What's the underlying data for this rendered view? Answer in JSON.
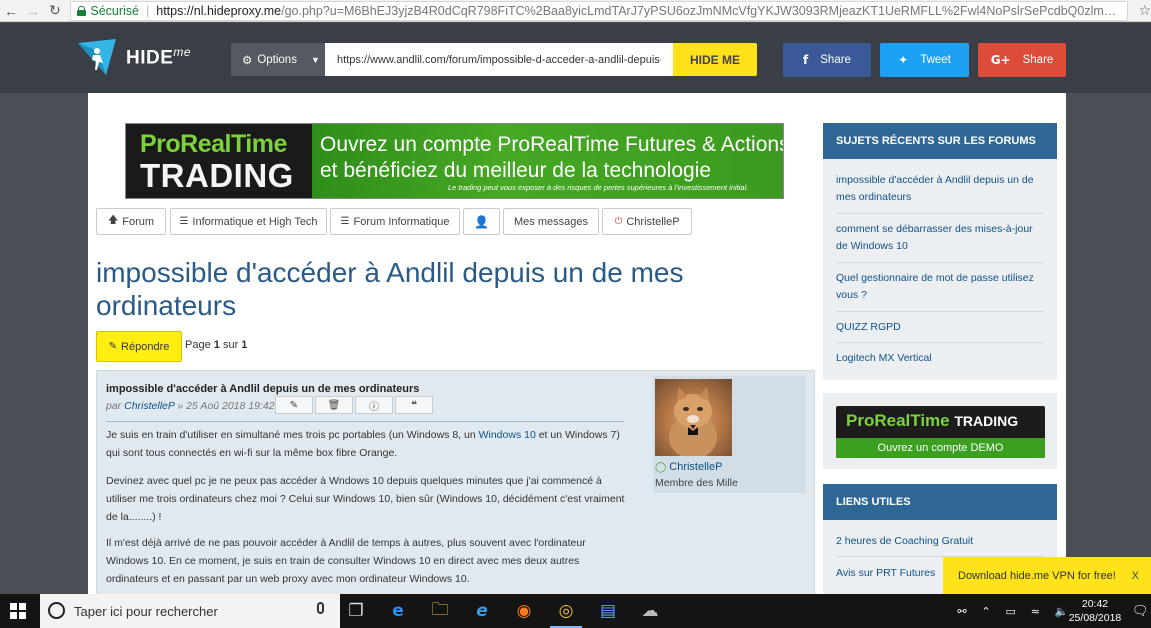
{
  "browser": {
    "secure_label": "Sécurisé",
    "url_host": "https://nl.hideproxy.me",
    "url_rest": "/go.php?u=M6BhEJ3yjzB4R0dCqR798FiTC%2Baa8yicLmdTArJ7yPSU6ozJmNMcVfgYKJW3093RMjeazKT1UeRMFLL%2Fwl4NoPslrSePcdbQ0zlm1ulve0ul8Dw..."
  },
  "hideme": {
    "logo_text": "HIDE",
    "logo_suffix": "me",
    "options_label": "Options",
    "url_value": "https://www.andlil.com/forum/impossible-d-acceder-a-andlil-depuis-un-de-mes",
    "hide_button": "HIDE ME",
    "fb_label": "Share",
    "tweet_label": "Tweet",
    "gplus_label": "Share",
    "brand_yellow": "#ffe21a"
  },
  "banner": {
    "brand_1": "ProRealTime",
    "brand_2": "TRADING",
    "line_1": "Ouvrez un compte ProRealTime Futures & Actions",
    "line_2": "et bénéficiez du meilleur de la technologie",
    "disclaimer": "Le trading peut vous exposer à des risques de pertes supérieures à l'investissement initial."
  },
  "forum_nav": [
    {
      "label": "Forum",
      "icon": "arrow-up-icon"
    },
    {
      "label": "Informatique et High Tech",
      "icon": "list-icon"
    },
    {
      "label": "Forum Informatique",
      "icon": "list-icon"
    },
    {
      "label": "",
      "icon": "user-icon"
    },
    {
      "label": "Mes messages",
      "icon": ""
    },
    {
      "label": "ChristelleP",
      "icon": "power-icon"
    }
  ],
  "thread": {
    "title": "impossible d'accéder à Andlil depuis un de mes ordinateurs",
    "reply_label": "Répondre",
    "page_word": "Page",
    "page_current": "1",
    "page_of": "sur",
    "page_total": "1"
  },
  "post": {
    "title": "impossible d'accéder à Andlil depuis un de mes ordinateurs",
    "by": "par",
    "author": "ChristelleP",
    "date": "» 25 Aoû 2018 19:42",
    "p1_a": "Je suis en train d'utiliser en simultané mes trois pc portables (un Windows 8, un ",
    "p1_link": "Windows 10",
    "p1_b": " et un Windows 7) qui sont tous connectés en wi-fi sur la même box fibre Orange.",
    "p2": "Devinez avec quel pc je ne peux pas accéder à Wndows 10 depuis quelques minutes que j'ai commencé à utiliser me trois ordinateurs chez moi ? Celui sur Windows 10, bien sûr (Windows 10, décidément c'est vraiment de la........) !",
    "p3": "Il m'est déjà arrivé de ne pas pouvoir accéder à Andlil de temps à autres, plus souvent avec l'ordinateur Windows 10. En ce moment, je suis en train de consulter Windows 10 en direct avec mes deux autres ordinateurs et en passant par un web proxy avec mon ordinateur Windows 10.",
    "author_name": "ChristelleP",
    "author_rank": "Membre des Mille"
  },
  "sidebar": {
    "recent_title": "SUJETS RÉCENTS SUR LES FORUMS",
    "recent": [
      "impossible d'accéder à Andlil depuis un de mes ordinateurs",
      "comment se débarrasser des mises-à-jour de Windows 10",
      "Quel gestionnaire de mot de passe utilisez vous ?",
      "QUIZZ RGPD",
      "Logitech MX Vertical"
    ],
    "ad_top": "ProRealTime",
    "ad_top_b": "TRADING",
    "ad_bottom": "Ouvrez un compte DEMO",
    "useful_title": "LIENS UTILES",
    "useful": [
      "2 heures de Coaching Gratuit",
      "Avis sur PRT Futures"
    ]
  },
  "toast": {
    "text": "Download hide.me VPN for free!",
    "close": "X"
  },
  "taskbar": {
    "search_placeholder": "Taper ici pour rechercher",
    "time": "20:42",
    "date": "25/08/2018"
  }
}
